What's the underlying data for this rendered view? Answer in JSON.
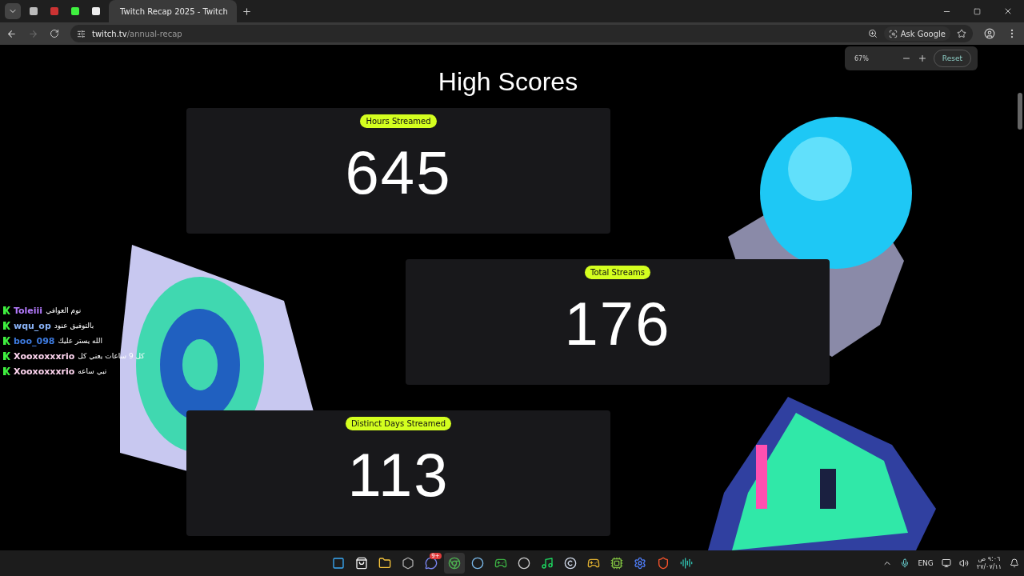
{
  "browser": {
    "tabs": [
      {
        "kind": "icon",
        "selected": false
      },
      {
        "kind": "icon",
        "selected": false
      },
      {
        "kind": "icon",
        "selected": false
      },
      {
        "kind": "icon",
        "selected": false
      },
      {
        "kind": "page",
        "title": "Twitch Recap 2025 - Twitch",
        "selected": true
      }
    ],
    "url_host": "twitch.tv",
    "url_path": "/annual-recap",
    "ask_google": "Ask Google"
  },
  "zoom_popup": {
    "value": "67%",
    "reset": "Reset"
  },
  "page": {
    "title": "High Scores",
    "stats": [
      {
        "label": "Hours Streamed",
        "value": "645"
      },
      {
        "label": "Total Streams",
        "value": "176"
      },
      {
        "label": "Distinct Days Streamed",
        "value": "113"
      }
    ]
  },
  "chat": [
    {
      "user": "Toleiii",
      "color": "#b57bff",
      "message": "نوم العوافي"
    },
    {
      "user": "wqu_op",
      "color": "#8ab4f8",
      "message": "بالتوفيق عنود"
    },
    {
      "user": "boo_098",
      "color": "#3d7be0",
      "message": "الله يستر عليك"
    },
    {
      "user": "Xooxoxxxrio",
      "color": "#ffd6f0",
      "message": "كل 9 ساعات يعني كل"
    },
    {
      "user": "Xooxoxxxrio",
      "color": "#ffd6f0",
      "message": "تبي ساعه"
    }
  ],
  "taskbar": {
    "apps": [
      {
        "kind": "start",
        "active": false
      },
      {
        "kind": "store",
        "active": false
      },
      {
        "kind": "folder",
        "active": false
      },
      {
        "kind": "hex",
        "active": false
      },
      {
        "kind": "discord",
        "active": false,
        "badge": "9+"
      },
      {
        "kind": "chrome",
        "active": true
      },
      {
        "kind": "steam",
        "active": false
      },
      {
        "kind": "xbox",
        "active": false
      },
      {
        "kind": "obs",
        "active": false
      },
      {
        "kind": "spotify",
        "active": false
      },
      {
        "kind": "c",
        "active": false
      },
      {
        "kind": "game",
        "active": false
      },
      {
        "kind": "gpu",
        "active": false
      },
      {
        "kind": "gear",
        "active": false
      },
      {
        "kind": "brave",
        "active": false
      },
      {
        "kind": "audio",
        "active": false
      }
    ],
    "language": "ENG",
    "time": "٩:٠٦ ص",
    "date": "٢٧/٠٧/١١"
  }
}
